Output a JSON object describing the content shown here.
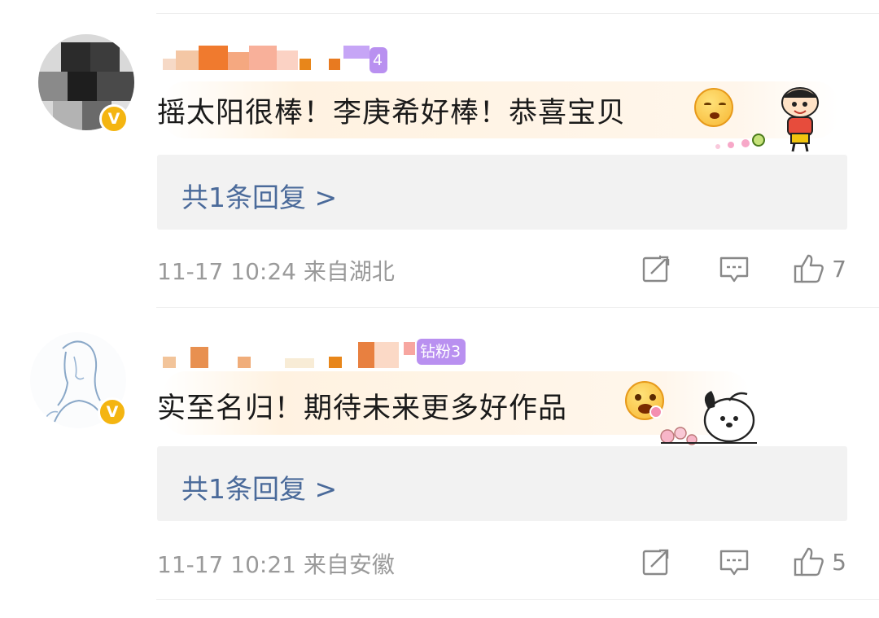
{
  "comments": [
    {
      "fan_badge": "4",
      "text": "摇太阳很棒！李庚希好棒！恭喜宝贝",
      "reply_link": "共1条回复 >",
      "time": "11-17 10:24",
      "location": "来自湖北",
      "likes": "7",
      "verified_badge": "V"
    },
    {
      "fan_badge": "钻粉3",
      "text": "实至名归！期待未来更多好作品",
      "reply_link": "共1条回复 >",
      "time": "11-17 10:21",
      "location": "来自安徽",
      "likes": "5",
      "verified_badge": "V"
    }
  ],
  "icons": {
    "repost": "repost-icon",
    "comment": "comment-icon",
    "like": "like-icon"
  },
  "colors": {
    "verified": "#f4b511",
    "fan_badge": "#b990f0",
    "reply_link": "#4a6a9a",
    "meta_text": "#9a9a9a"
  }
}
